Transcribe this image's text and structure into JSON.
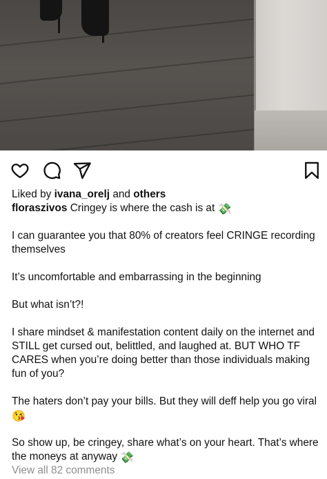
{
  "post": {
    "likes": {
      "prefix": "Liked by",
      "user": "ivana_orelj",
      "connector": "and",
      "others": "others"
    },
    "caption": {
      "username": "floraszivos",
      "first_line": "Cringey is where the cash is at",
      "money_emoji": "💸",
      "kiss_emoji": "😘",
      "p1": "I can guarantee you that 80% of creators feel CRINGE recording themselves",
      "p2": "It’s uncomfortable and embarrassing in the beginning",
      "p3": "But what isn’t?!",
      "p4": "I share mindset & manifestation content daily on the internet and STILL get cursed out, belittled, and laughed at. BUT WHO TF CARES when you’re doing better than those individuals making fun of you?",
      "p5": "The haters don’t pay your bills. But they will deff help you go viral",
      "p6": "So show up, be cringey, share what’s on your heart. That’s where the moneys at anyway"
    },
    "comments_link": "View all 82 comments"
  },
  "icons": {
    "like": "heart-icon",
    "comment": "comment-icon",
    "share": "paper-plane-icon",
    "save": "bookmark-icon"
  }
}
